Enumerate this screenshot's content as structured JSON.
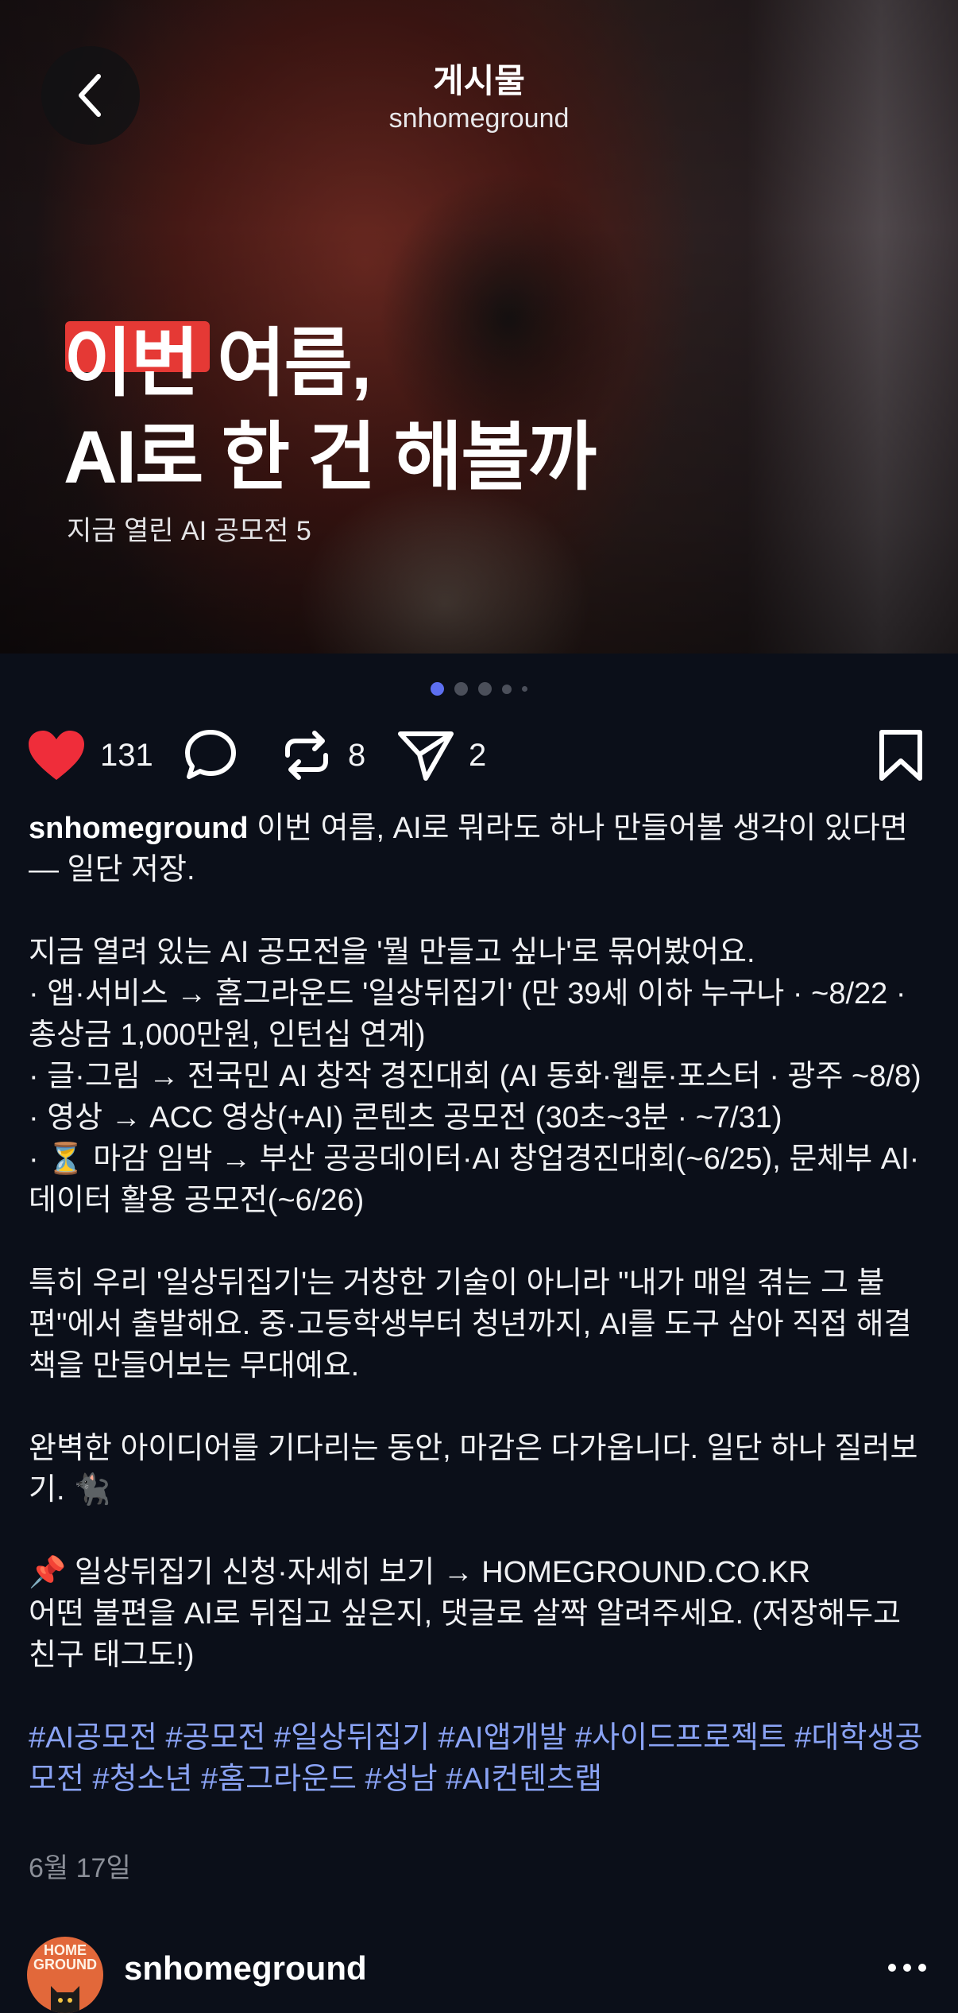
{
  "header": {
    "title": "게시물",
    "subtitle": "snhomeground"
  },
  "hero": {
    "headline_line1": "이번 여름,",
    "headline_line2": "AI로 한 건 해볼까",
    "subtext": "지금 열린 AI 공모전 5",
    "highlight_color": "#e53935"
  },
  "carousel": {
    "total": 5,
    "active_index": 0,
    "active_color": "#5d6ff0"
  },
  "actions": {
    "like_icon": "heart-filled-icon",
    "like_color": "#ef2d3a",
    "likes": "131",
    "comment_icon": "comment-bubble-icon",
    "repost_icon": "repost-icon",
    "reposts": "8",
    "share_icon": "send-icon",
    "shares": "2",
    "bookmark_icon": "bookmark-icon"
  },
  "post": {
    "username": "snhomeground",
    "intro": " 이번 여름, AI로 뭐라도 하나 만들어볼 생각이 있다면 — 일단 저장.",
    "line_summary": "지금 열려 있는 AI 공모전을 '뭘 만들고 싶나'로 묶어봤어요.",
    "bullet1": "· 앱·서비스 → 홈그라운드 '일상뒤집기' (만 39세 이하 누구나 · ~8/22 · 총상금 1,000만원, 인턴십 연계)",
    "bullet2": "· 글·그림 → 전국민 AI 창작 경진대회 (AI 동화·웹툰·포스터 · 광주 ~8/8)",
    "bullet3": "· 영상 → ACC 영상(+AI) 콘텐츠 공모전 (30초~3분 · ~7/31)",
    "bullet4": "· ⏳ 마감 임박 → 부산 공공데이터·AI 창업경진대회(~6/25), 문체부 AI·데이터 활용 공모전(~6/26)",
    "para_highlight": "특히 우리 '일상뒤집기'는 거창한 기술이 아니라 \"내가 매일 겪는 그 불편\"에서 출발해요. 중·고등학생부터 청년까지, AI를 도구 삼아 직접 해결책을 만들어보는 무대예요.",
    "para_deadline": "완벽한 아이디어를 기다리는 동안, 마감은 다가옵니다. 일단 하나 질러보기. 🐈‍⬛",
    "cta_link_line": "📌 일상뒤집기 신청·자세히 보기 → HOMEGROUND.CO.KR",
    "cta_ask_line": "어떤 불편을 AI로 뒤집고 싶은지, 댓글로 살짝 알려주세요. (저장해두고 친구 태그도!)",
    "hashtags": "#AI공모전 #공모전 #일상뒤집기 #AI앱개발 #사이드프로젝트 #대학생공모전 #청소년 #홈그라운드 #성남 #AI컨텐츠랩",
    "date": "6월 17일"
  },
  "next_post": {
    "avatar_text": "HOME GROUND",
    "username": "snhomeground",
    "more_icon": "more-dots-icon"
  }
}
